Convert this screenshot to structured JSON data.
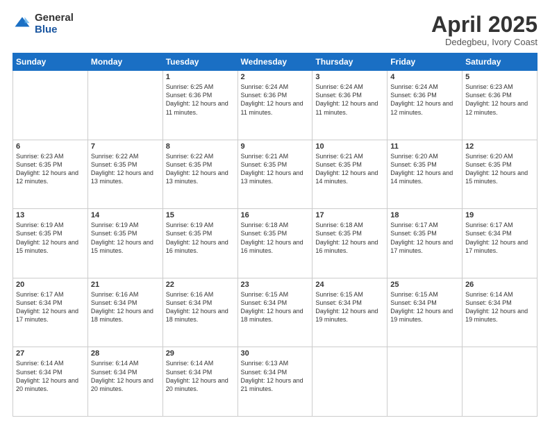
{
  "logo": {
    "general": "General",
    "blue": "Blue"
  },
  "title": "April 2025",
  "subtitle": "Dedegbeu, Ivory Coast",
  "days_of_week": [
    "Sunday",
    "Monday",
    "Tuesday",
    "Wednesday",
    "Thursday",
    "Friday",
    "Saturday"
  ],
  "weeks": [
    [
      {
        "day": "",
        "info": ""
      },
      {
        "day": "",
        "info": ""
      },
      {
        "day": "1",
        "info": "Sunrise: 6:25 AM\nSunset: 6:36 PM\nDaylight: 12 hours and 11 minutes."
      },
      {
        "day": "2",
        "info": "Sunrise: 6:24 AM\nSunset: 6:36 PM\nDaylight: 12 hours and 11 minutes."
      },
      {
        "day": "3",
        "info": "Sunrise: 6:24 AM\nSunset: 6:36 PM\nDaylight: 12 hours and 11 minutes."
      },
      {
        "day": "4",
        "info": "Sunrise: 6:24 AM\nSunset: 6:36 PM\nDaylight: 12 hours and 12 minutes."
      },
      {
        "day": "5",
        "info": "Sunrise: 6:23 AM\nSunset: 6:36 PM\nDaylight: 12 hours and 12 minutes."
      }
    ],
    [
      {
        "day": "6",
        "info": "Sunrise: 6:23 AM\nSunset: 6:35 PM\nDaylight: 12 hours and 12 minutes."
      },
      {
        "day": "7",
        "info": "Sunrise: 6:22 AM\nSunset: 6:35 PM\nDaylight: 12 hours and 13 minutes."
      },
      {
        "day": "8",
        "info": "Sunrise: 6:22 AM\nSunset: 6:35 PM\nDaylight: 12 hours and 13 minutes."
      },
      {
        "day": "9",
        "info": "Sunrise: 6:21 AM\nSunset: 6:35 PM\nDaylight: 12 hours and 13 minutes."
      },
      {
        "day": "10",
        "info": "Sunrise: 6:21 AM\nSunset: 6:35 PM\nDaylight: 12 hours and 14 minutes."
      },
      {
        "day": "11",
        "info": "Sunrise: 6:20 AM\nSunset: 6:35 PM\nDaylight: 12 hours and 14 minutes."
      },
      {
        "day": "12",
        "info": "Sunrise: 6:20 AM\nSunset: 6:35 PM\nDaylight: 12 hours and 15 minutes."
      }
    ],
    [
      {
        "day": "13",
        "info": "Sunrise: 6:19 AM\nSunset: 6:35 PM\nDaylight: 12 hours and 15 minutes."
      },
      {
        "day": "14",
        "info": "Sunrise: 6:19 AM\nSunset: 6:35 PM\nDaylight: 12 hours and 15 minutes."
      },
      {
        "day": "15",
        "info": "Sunrise: 6:19 AM\nSunset: 6:35 PM\nDaylight: 12 hours and 16 minutes."
      },
      {
        "day": "16",
        "info": "Sunrise: 6:18 AM\nSunset: 6:35 PM\nDaylight: 12 hours and 16 minutes."
      },
      {
        "day": "17",
        "info": "Sunrise: 6:18 AM\nSunset: 6:35 PM\nDaylight: 12 hours and 16 minutes."
      },
      {
        "day": "18",
        "info": "Sunrise: 6:17 AM\nSunset: 6:35 PM\nDaylight: 12 hours and 17 minutes."
      },
      {
        "day": "19",
        "info": "Sunrise: 6:17 AM\nSunset: 6:34 PM\nDaylight: 12 hours and 17 minutes."
      }
    ],
    [
      {
        "day": "20",
        "info": "Sunrise: 6:17 AM\nSunset: 6:34 PM\nDaylight: 12 hours and 17 minutes."
      },
      {
        "day": "21",
        "info": "Sunrise: 6:16 AM\nSunset: 6:34 PM\nDaylight: 12 hours and 18 minutes."
      },
      {
        "day": "22",
        "info": "Sunrise: 6:16 AM\nSunset: 6:34 PM\nDaylight: 12 hours and 18 minutes."
      },
      {
        "day": "23",
        "info": "Sunrise: 6:15 AM\nSunset: 6:34 PM\nDaylight: 12 hours and 18 minutes."
      },
      {
        "day": "24",
        "info": "Sunrise: 6:15 AM\nSunset: 6:34 PM\nDaylight: 12 hours and 19 minutes."
      },
      {
        "day": "25",
        "info": "Sunrise: 6:15 AM\nSunset: 6:34 PM\nDaylight: 12 hours and 19 minutes."
      },
      {
        "day": "26",
        "info": "Sunrise: 6:14 AM\nSunset: 6:34 PM\nDaylight: 12 hours and 19 minutes."
      }
    ],
    [
      {
        "day": "27",
        "info": "Sunrise: 6:14 AM\nSunset: 6:34 PM\nDaylight: 12 hours and 20 minutes."
      },
      {
        "day": "28",
        "info": "Sunrise: 6:14 AM\nSunset: 6:34 PM\nDaylight: 12 hours and 20 minutes."
      },
      {
        "day": "29",
        "info": "Sunrise: 6:14 AM\nSunset: 6:34 PM\nDaylight: 12 hours and 20 minutes."
      },
      {
        "day": "30",
        "info": "Sunrise: 6:13 AM\nSunset: 6:34 PM\nDaylight: 12 hours and 21 minutes."
      },
      {
        "day": "",
        "info": ""
      },
      {
        "day": "",
        "info": ""
      },
      {
        "day": "",
        "info": ""
      }
    ]
  ]
}
